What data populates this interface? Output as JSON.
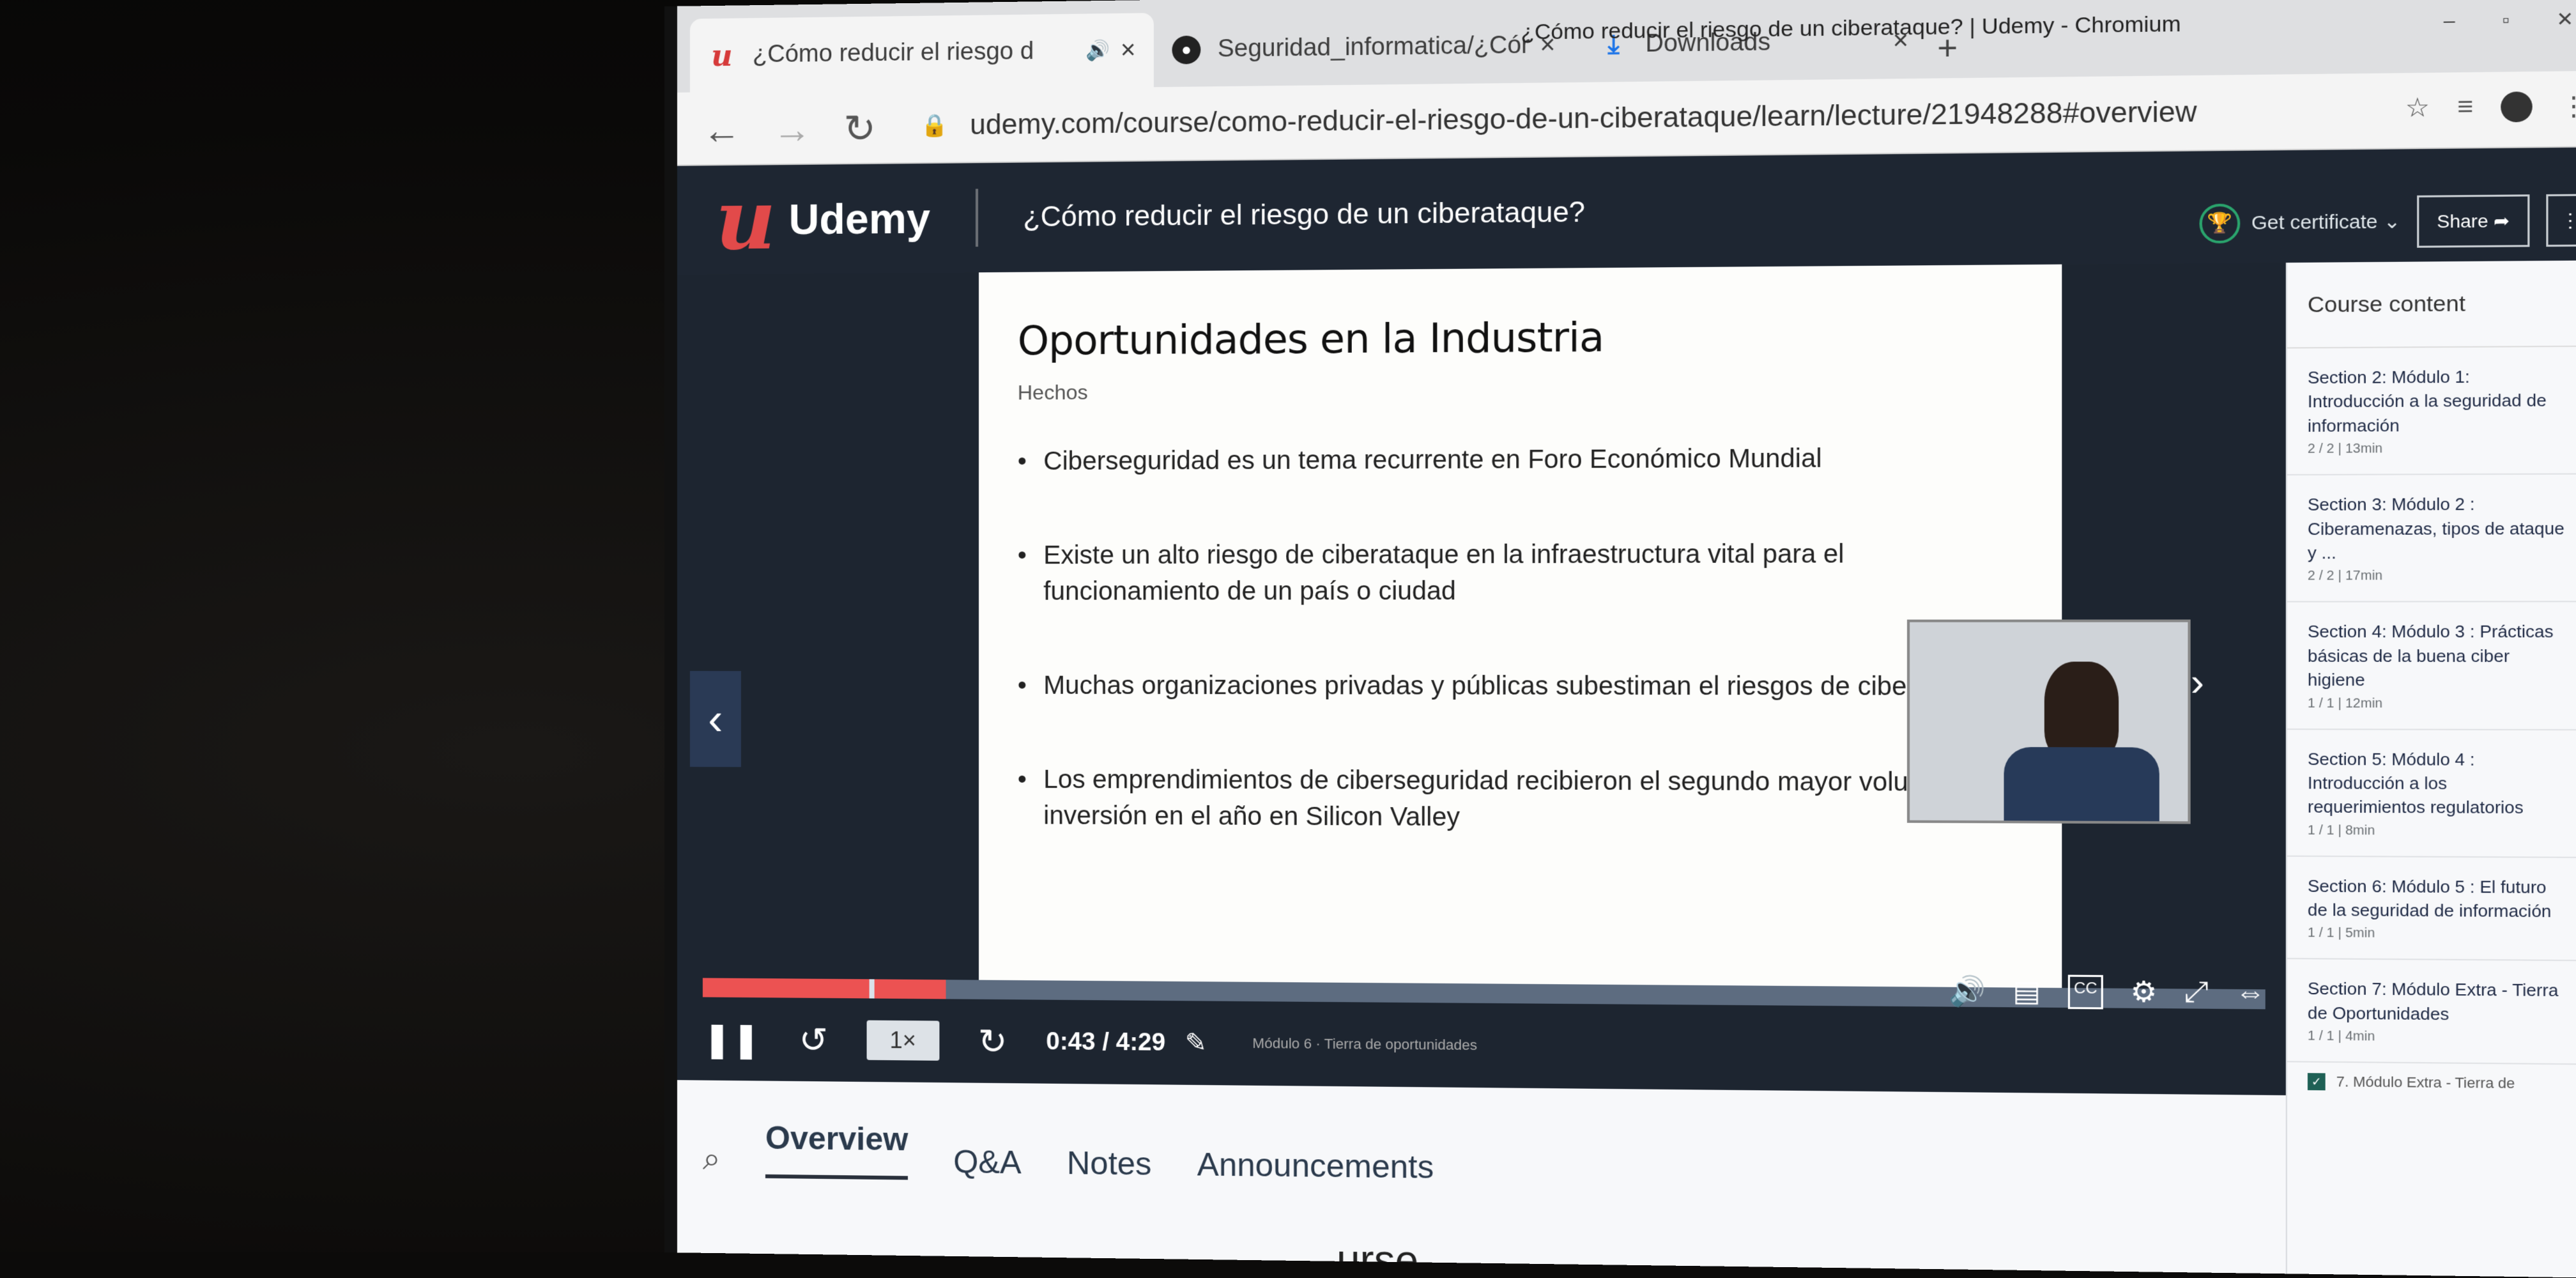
{
  "browser": {
    "window_title": "¿Cómo reducir el riesgo de un ciberataque? | Udemy - Chromium",
    "tabs": [
      {
        "label": "¿Cómo reducir el riesgo d",
        "favicon": "udemy-icon",
        "active": true
      },
      {
        "label": "Seguridad_informatica/¿Cóm",
        "favicon": "github-icon",
        "active": false
      },
      {
        "label": "Downloads",
        "favicon": "download-icon",
        "active": false
      }
    ],
    "url": "udemy.com/course/como-reducir-el-riesgo-de-un-ciberataque/learn/lecture/21948288#overview"
  },
  "header": {
    "logo_text": "Udemy",
    "course_title": "¿Cómo reducir el riesgo de un ciberataque?",
    "get_certificate": "Get certificate",
    "share": "Share",
    "more": "⋮"
  },
  "slide": {
    "title": "Oportunidades en la Industria",
    "subtitle": "Hechos",
    "bullets": [
      "Ciberseguridad es un tema recurrente en Foro Económico Mundial",
      "Existe un alto riesgo de ciberataque en la infraestructura vital para el funcionamiento de un país o ciudad",
      "Muchas organizaciones privadas y públicas subestiman el riesgos de ciberataques",
      "Los emprendimientos de ciberseguridad recibieron el segundo mayor volumen de inversión en el año en Silicon Valley"
    ]
  },
  "player": {
    "speed": "1×",
    "time": "0:43 / 4:29",
    "lecture_name": "Módulo 6 · Tierra de oportunidades",
    "progress_fraction": 0.16,
    "accent": "#ec5252"
  },
  "lower_tabs": {
    "items": [
      "Overview",
      "Q&A",
      "Notes",
      "Announcements"
    ],
    "active": "Overview",
    "peek_text": "urse"
  },
  "sidebar": {
    "title": "Course content",
    "close": "X",
    "sections": [
      {
        "title": "Section 2: Módulo 1: Introducción a la seguridad de información",
        "meta": "2 / 2 | 13min"
      },
      {
        "title": "Section 3: Módulo 2 : Ciberamenazas, tipos de ataque y ...",
        "meta": "2 / 2 | 17min"
      },
      {
        "title": "Section 4: Módulo 3 : Prácticas básicas de la buena ciber higiene",
        "meta": "1 / 1 | 12min"
      },
      {
        "title": "Section 5: Módulo 4 : Introducción a los requerimientos regulatorios",
        "meta": "1 / 1 | 8min"
      },
      {
        "title": "Section 6: Módulo 5 : El futuro de la seguridad de información",
        "meta": "1 / 1 | 5min"
      },
      {
        "title": "Section 7: Módulo Extra - Tierra de Oportunidades",
        "meta": "1 / 1 | 4min"
      }
    ],
    "lecture": "7. Módulo Extra - Tierra de"
  }
}
